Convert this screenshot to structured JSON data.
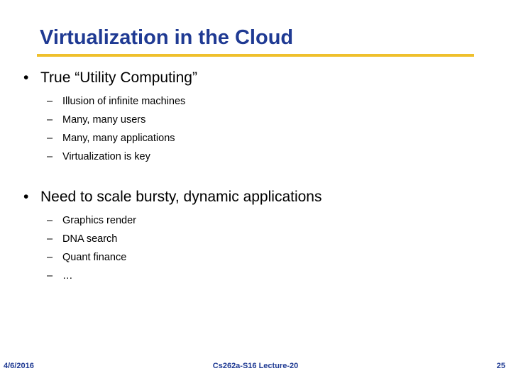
{
  "slide": {
    "title": "Virtualization in the Cloud",
    "title_color": "#1F3A93",
    "rule_color": "#EFC02C",
    "background_color": "#FFFFFF",
    "body_text_color": "#000000",
    "bullet_marker": "•",
    "sub_bullet_marker": "–",
    "blocks": [
      {
        "heading": "True “Utility Computing”",
        "items": [
          "Illusion of infinite machines",
          "Many, many users",
          "Many, many applications",
          "Virtualization is key"
        ]
      },
      {
        "heading": "Need to scale bursty, dynamic applications",
        "items": [
          "Graphics render",
          "DNA search",
          "Quant finance",
          "…"
        ]
      }
    ]
  },
  "footer": {
    "date": "4/6/2016",
    "center": "Cs262a-S16 Lecture-20",
    "page_number": "25",
    "color": "#1F3A93"
  }
}
